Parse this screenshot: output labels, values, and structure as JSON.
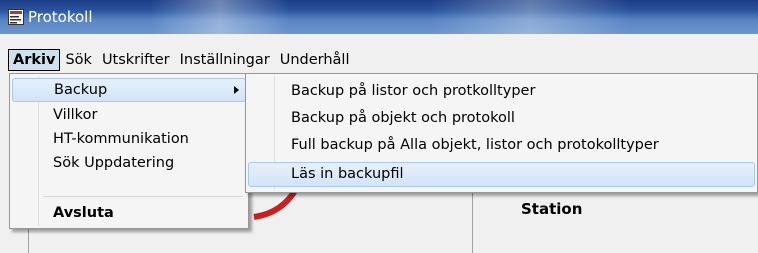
{
  "window": {
    "title": "Protokoll"
  },
  "menubar": {
    "items": [
      "Arkiv",
      "Sök",
      "Utskrifter",
      "Inställningar",
      "Underhåll"
    ]
  },
  "arkiv_menu": {
    "items": [
      "Backup",
      "Villkor",
      "HT-kommunikation",
      "Sök Uppdatering",
      "Avsluta"
    ]
  },
  "backup_submenu": {
    "items": [
      "Backup på listor och protkolltyper",
      "Backup på objekt och protokoll",
      "Full backup på Alla objekt, listor och protokolltyper",
      "Läs in backupfil"
    ]
  },
  "background": {
    "station_label": "Station"
  },
  "colors": {
    "titlebar": "#29549e",
    "highlight": "#d2e4f8",
    "menu_active": "#cfe0ee"
  }
}
